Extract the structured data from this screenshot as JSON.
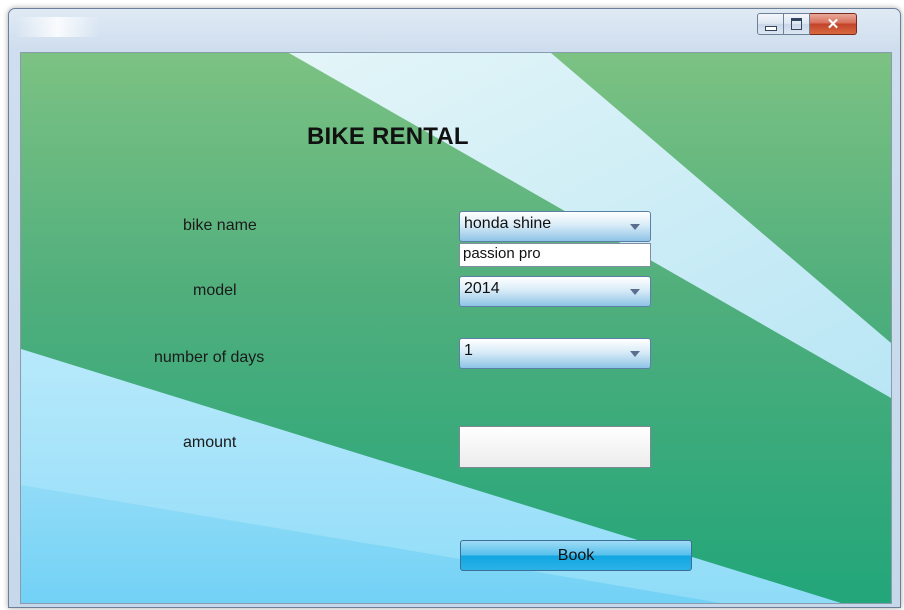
{
  "window": {
    "minimize_icon": "minimize-icon",
    "maximize_icon": "maximize-icon",
    "close_icon": "close-icon",
    "close_glyph": "✕"
  },
  "form": {
    "title": "BIKE RENTAL",
    "bike_name": {
      "label": "bike name",
      "selected": "honda shine",
      "options_visible": [
        "passion pro"
      ]
    },
    "model": {
      "label": "model",
      "selected": "2014"
    },
    "days": {
      "label": "number of days",
      "selected": "1"
    },
    "amount": {
      "label": "amount",
      "value": ""
    },
    "book_label": "Book"
  },
  "colors": {
    "background_green": "#22a67a",
    "background_light_green": "#7cc283",
    "ribbon_light_blue": "#c8eefc",
    "button_blue": "#12a6e1"
  }
}
